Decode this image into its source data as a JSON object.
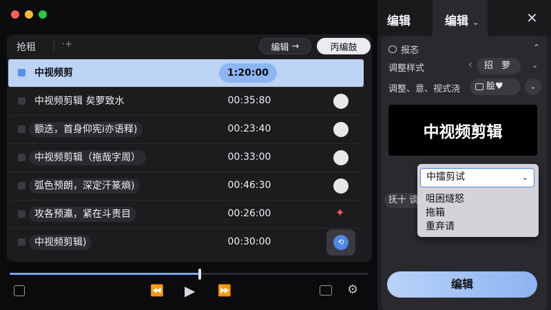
{
  "toolbar": {
    "title": "抢租",
    "add_glyph": "·+",
    "edit_label": "编辑",
    "edit_arrow": "→",
    "second_label": "丙编鼓"
  },
  "rows": [
    {
      "label": "中视频剪",
      "time": "1:20:00",
      "marker": "none",
      "selected": true
    },
    {
      "label": "中视频剪辑  矣萝致水",
      "time": "00:35:80",
      "marker": "circle"
    },
    {
      "label": "额迭，首身仰宪i亦语释)",
      "time": "00:23:40",
      "marker": "circle"
    },
    {
      "label": "中视频剪辑（拖哉字周）",
      "time": "00:33:00",
      "marker": "circle"
    },
    {
      "label": "弧色预朗，深定汗篆熵)",
      "time": "00:46:30",
      "marker": "circle"
    },
    {
      "label": "攻各预瀛，紧在斗责目",
      "time": "00:26:00",
      "marker": "star"
    },
    {
      "label": "中视频剪辑)",
      "time": "00:30:00",
      "marker": "active"
    }
  ],
  "transport": {
    "progress": 0.53,
    "rewind_icon": "⏪",
    "play_icon": "▶",
    "forward_icon": "⏩",
    "gear_icon": "⚙"
  },
  "right": {
    "tab_1": "编辑",
    "tab_2": "编辑",
    "close_icon": "✕",
    "section_title": "报忞",
    "prop_1_label": "调整样式",
    "prop_1_value": "招 萝",
    "prop_2_label": "调整、意、视式浇",
    "prop_2_value": "脍♥",
    "preview_text": "中视频剪辑",
    "side_label": "抚十 谈",
    "dropdown_selected": "中擂剪试",
    "dropdown_options": [
      "咀困燧怒",
      "拖箱",
      "重弃请"
    ],
    "primary_button": "编辑"
  },
  "colors": {
    "accent": "#8cb6f3",
    "selected_row": "#bcd3f6",
    "star": "#ff5a5a"
  }
}
